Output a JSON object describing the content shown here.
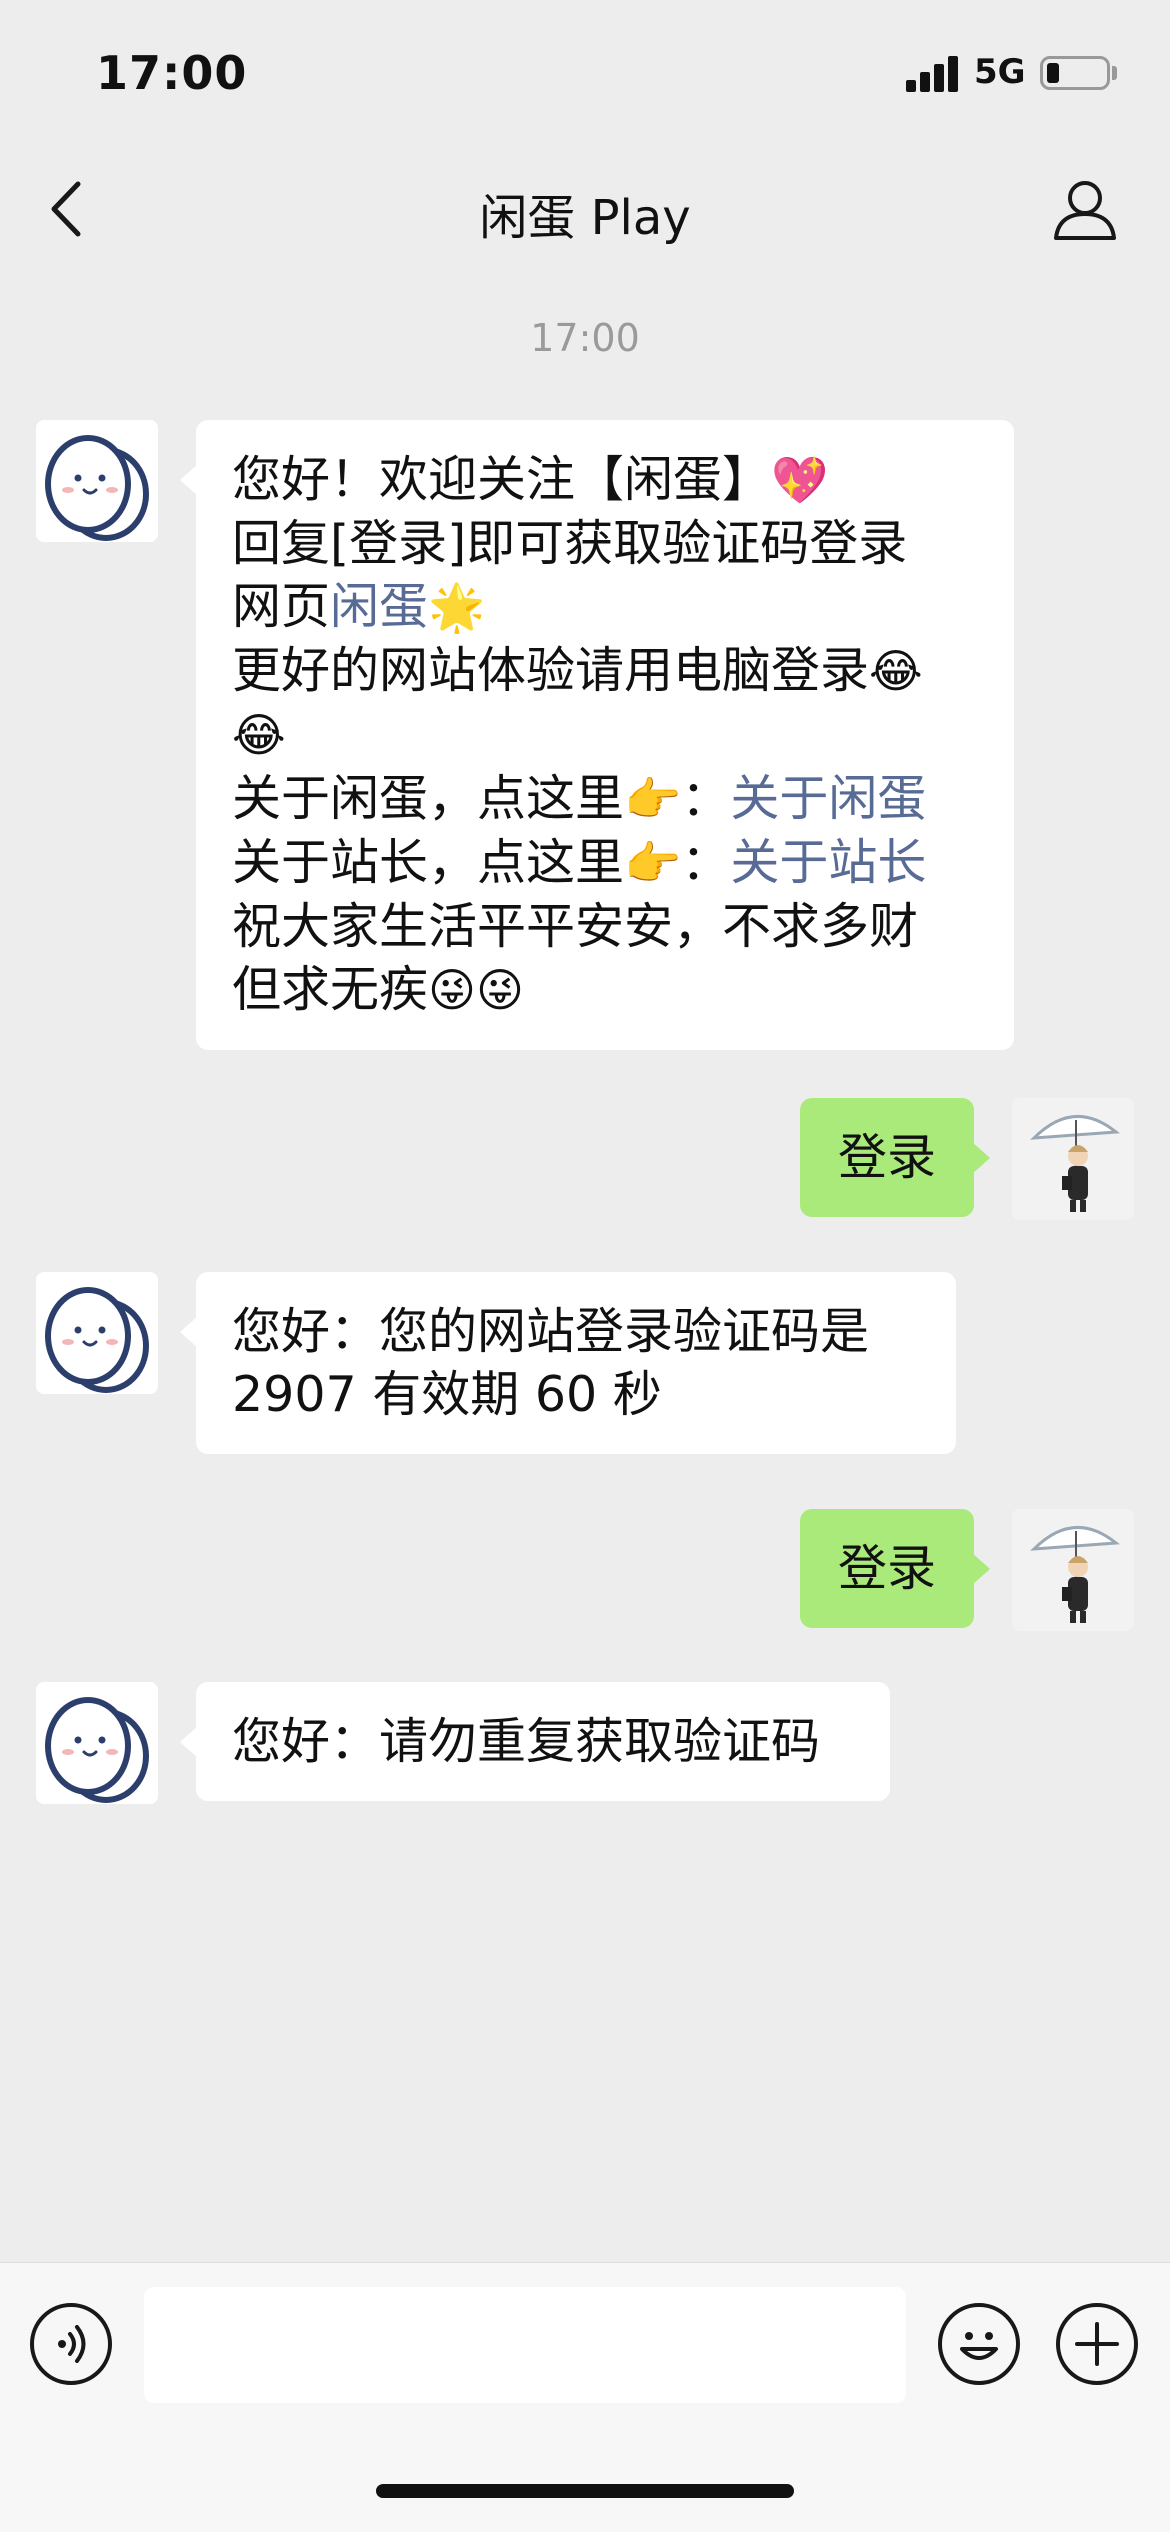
{
  "status_bar": {
    "time": "17:00",
    "network": "5G"
  },
  "nav": {
    "title": "闲蛋 Play"
  },
  "timestamp": "17:00",
  "messages": {
    "m1": {
      "l1": "您好！欢迎关注【闲蛋】",
      "l1_emoji": "💖",
      "l2": "回复[登录]即可获取验证码登录",
      "l3_text": "网页",
      "l3_link": "闲蛋",
      "l3_emoji": "🌟",
      "l4": "更好的网站体验请用电脑登录",
      "l4_emoji": "😂",
      "l5_emoji": "😂",
      "l6_text": "关于闲蛋，点这里",
      "l6_emoji": "👉",
      "l6_sep": "：",
      "l6_link": "关于闲蛋",
      "l7_text": "关于站长，点这里",
      "l7_emoji": "👉",
      "l7_sep": "：",
      "l7_link": "关于站长",
      "l8": "祝大家生活平平安安，不求多财",
      "l9": "但求无疾",
      "l9_emoji": "😜😜"
    },
    "m2": "登录",
    "m3": {
      "l1": "您好：您的网站登录验证码是",
      "l2": "2907 有效期 60 秒"
    },
    "m4": "登录",
    "m5": "您好：请勿重复获取验证码"
  },
  "input": {
    "placeholder": ""
  },
  "colors": {
    "outgoing_bubble": "#a9ea7a",
    "link": "#576b95",
    "background": "#ededed"
  }
}
